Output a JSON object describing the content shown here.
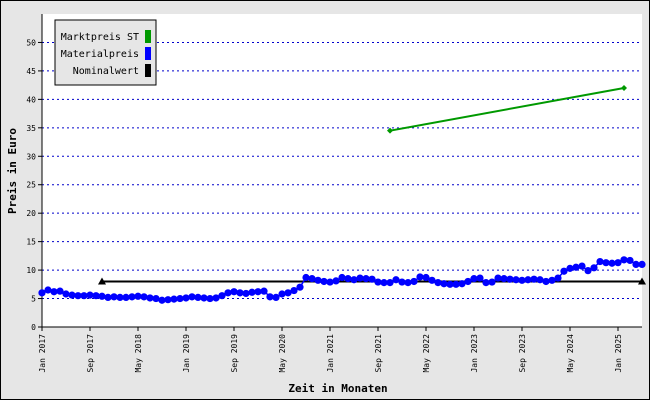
{
  "chart_data": {
    "type": "line",
    "xlabel": "Zeit in Monaten",
    "ylabel": "Preis in Euro",
    "ylim": [
      0,
      55
    ],
    "yticks": [
      0,
      5,
      10,
      15,
      20,
      25,
      30,
      35,
      40,
      45,
      50
    ],
    "x_start": "2017-01",
    "x_end": "2025-05",
    "xtick_labels": [
      "Jan 2017",
      "Sep 2017",
      "May 2018",
      "Jan 2019",
      "Sep 2019",
      "May 2020",
      "Jan 2021",
      "Sep 2021",
      "May 2022",
      "Jan 2023",
      "Sep 2023",
      "May 2024",
      "Jan 2025"
    ],
    "grid": true,
    "legend_position": "top-left",
    "series": [
      {
        "name": "Marktpreis ST",
        "color": "#009900",
        "marker": "diamond",
        "points": [
          [
            "2021-11",
            34.5
          ],
          [
            "2025-02",
            42.0
          ]
        ]
      },
      {
        "name": "Materialpreis",
        "color": "#0000ff",
        "marker": "circle",
        "points": [
          [
            "2017-01",
            6.0
          ],
          [
            "2017-02",
            6.5
          ],
          [
            "2017-03",
            6.2
          ],
          [
            "2017-04",
            6.3
          ],
          [
            "2017-05",
            5.8
          ],
          [
            "2017-06",
            5.6
          ],
          [
            "2017-07",
            5.5
          ],
          [
            "2017-08",
            5.5
          ],
          [
            "2017-09",
            5.6
          ],
          [
            "2017-10",
            5.5
          ],
          [
            "2017-11",
            5.4
          ],
          [
            "2017-12",
            5.2
          ],
          [
            "2018-01",
            5.3
          ],
          [
            "2018-02",
            5.2
          ],
          [
            "2018-03",
            5.2
          ],
          [
            "2018-04",
            5.3
          ],
          [
            "2018-05",
            5.4
          ],
          [
            "2018-06",
            5.3
          ],
          [
            "2018-07",
            5.1
          ],
          [
            "2018-08",
            5.0
          ],
          [
            "2018-09",
            4.7
          ],
          [
            "2018-10",
            4.8
          ],
          [
            "2018-11",
            4.9
          ],
          [
            "2018-12",
            5.0
          ],
          [
            "2019-01",
            5.1
          ],
          [
            "2019-02",
            5.3
          ],
          [
            "2019-03",
            5.2
          ],
          [
            "2019-04",
            5.1
          ],
          [
            "2019-05",
            5.0
          ],
          [
            "2019-06",
            5.1
          ],
          [
            "2019-07",
            5.5
          ],
          [
            "2019-08",
            6.0
          ],
          [
            "2019-09",
            6.2
          ],
          [
            "2019-10",
            6.0
          ],
          [
            "2019-11",
            5.9
          ],
          [
            "2019-12",
            6.1
          ],
          [
            "2020-01",
            6.2
          ],
          [
            "2020-02",
            6.3
          ],
          [
            "2020-03",
            5.3
          ],
          [
            "2020-04",
            5.2
          ],
          [
            "2020-05",
            5.8
          ],
          [
            "2020-06",
            6.0
          ],
          [
            "2020-07",
            6.4
          ],
          [
            "2020-08",
            7.0
          ],
          [
            "2020-09",
            8.7
          ],
          [
            "2020-10",
            8.5
          ],
          [
            "2020-11",
            8.2
          ],
          [
            "2020-12",
            8.0
          ],
          [
            "2021-01",
            7.9
          ],
          [
            "2021-02",
            8.1
          ],
          [
            "2021-03",
            8.7
          ],
          [
            "2021-04",
            8.5
          ],
          [
            "2021-05",
            8.3
          ],
          [
            "2021-06",
            8.6
          ],
          [
            "2021-07",
            8.5
          ],
          [
            "2021-08",
            8.4
          ],
          [
            "2021-09",
            7.9
          ],
          [
            "2021-10",
            7.8
          ],
          [
            "2021-11",
            7.8
          ],
          [
            "2021-12",
            8.3
          ],
          [
            "2022-01",
            7.9
          ],
          [
            "2022-02",
            7.8
          ],
          [
            "2022-03",
            8.0
          ],
          [
            "2022-04",
            8.8
          ],
          [
            "2022-05",
            8.7
          ],
          [
            "2022-06",
            8.2
          ],
          [
            "2022-07",
            7.8
          ],
          [
            "2022-08",
            7.6
          ],
          [
            "2022-09",
            7.5
          ],
          [
            "2022-10",
            7.5
          ],
          [
            "2022-11",
            7.6
          ],
          [
            "2022-12",
            8.0
          ],
          [
            "2023-01",
            8.5
          ],
          [
            "2023-02",
            8.6
          ],
          [
            "2023-03",
            7.8
          ],
          [
            "2023-04",
            7.9
          ],
          [
            "2023-05",
            8.6
          ],
          [
            "2023-06",
            8.5
          ],
          [
            "2023-07",
            8.4
          ],
          [
            "2023-08",
            8.3
          ],
          [
            "2023-09",
            8.2
          ],
          [
            "2023-10",
            8.3
          ],
          [
            "2023-11",
            8.4
          ],
          [
            "2023-12",
            8.3
          ],
          [
            "2024-01",
            8.0
          ],
          [
            "2024-02",
            8.2
          ],
          [
            "2024-03",
            8.6
          ],
          [
            "2024-04",
            9.8
          ],
          [
            "2024-05",
            10.3
          ],
          [
            "2024-06",
            10.5
          ],
          [
            "2024-07",
            10.7
          ],
          [
            "2024-08",
            9.9
          ],
          [
            "2024-09",
            10.4
          ],
          [
            "2024-10",
            11.5
          ],
          [
            "2024-11",
            11.3
          ],
          [
            "2024-12",
            11.2
          ],
          [
            "2025-01",
            11.3
          ],
          [
            "2025-02",
            11.8
          ],
          [
            "2025-03",
            11.7
          ],
          [
            "2025-04",
            11.0
          ],
          [
            "2025-05",
            11.0
          ]
        ]
      },
      {
        "name": "Nominalwert",
        "color": "#000000",
        "marker": "triangle",
        "points": [
          [
            "2017-11",
            8.0
          ],
          [
            "2025-05",
            8.0
          ]
        ]
      }
    ]
  }
}
